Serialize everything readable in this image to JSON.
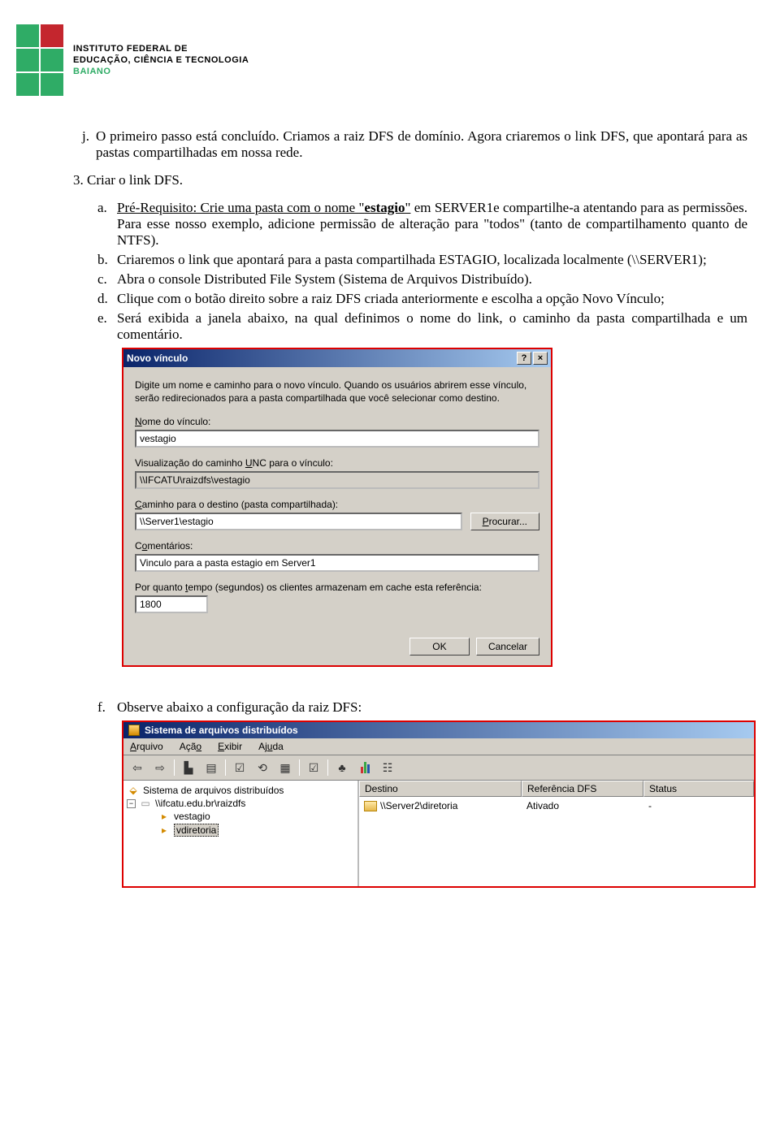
{
  "logo": {
    "line1": "INSTITUTO FEDERAL DE",
    "line2": "EDUCAÇÃO, CIÊNCIA E TECNOLOGIA",
    "line3": "BAIANO"
  },
  "item_j": {
    "marker": "j.",
    "text": "O primeiro passo está concluído. Criamos a raiz DFS de domínio. Agora criaremos o link DFS, que apontará para as pastas compartilhadas em nossa rede."
  },
  "step3": {
    "marker": "3.",
    "text": "Criar o link DFS."
  },
  "sub": {
    "a": {
      "marker": "a.",
      "pre": "Pré-Requisito: Crie uma pasta com o nome ",
      "quote_open": "\"",
      "link": "estagio",
      "quote_close": "\"",
      "post": " em SERVER1e compartilhe-a atentando para as permissões. Para esse nosso exemplo, adicione permissão de alteração para \"todos\" (tanto de compartilhamento quanto de NTFS)."
    },
    "b": {
      "marker": "b.",
      "text": "Criaremos o link que apontará para a pasta compartilhada ESTAGIO, localizada localmente (\\\\SERVER1);"
    },
    "c": {
      "marker": "c.",
      "text": "Abra o console Distributed File System (Sistema de Arquivos Distribuído)."
    },
    "d": {
      "marker": "d.",
      "text": "Clique com o botão direito sobre a raiz DFS criada anteriormente e escolha a opção Novo Vínculo;"
    },
    "e": {
      "marker": "e.",
      "text": "Será exibida a janela abaixo, na qual definimos o nome do link, o caminho da pasta compartilhada e um comentário."
    },
    "f": {
      "marker": "f.",
      "text": "Observe abaixo a configuração da raiz DFS:"
    }
  },
  "dialog": {
    "title": "Novo vínculo",
    "intro": "Digite um nome e caminho para o novo vínculo. Quando os usuários abrirem esse vínculo, serão redirecionados para a pasta compartilhada que você selecionar como destino.",
    "label_nome_pre": "N",
    "label_nome_post": "ome do vínculo:",
    "val_nome": "vestagio",
    "label_unc_pre": "Visualização do caminho ",
    "label_unc_u": "U",
    "label_unc_post": "NC para o vínculo:",
    "val_unc": "\\\\IFCATU\\raizdfs\\vestagio",
    "label_caminho_pre": "C",
    "label_caminho_post": "aminho para o destino (pasta compartilhada):",
    "val_caminho": "\\\\Server1\\estagio",
    "btn_procurar_pre": "P",
    "btn_procurar_post": "rocurar...",
    "label_coment_pre": "C",
    "label_coment_u": "o",
    "label_coment_post": "mentários:",
    "val_coment": "Vinculo para a pasta estagio em Server1",
    "label_cache_pre": "Por quanto ",
    "label_cache_u": "t",
    "label_cache_post": "empo (segundos) os clientes armazenam em cache esta referência:",
    "val_cache": "1800",
    "btn_ok": "OK",
    "btn_cancel": "Cancelar",
    "help": "?",
    "close": "×"
  },
  "mmc": {
    "title": "Sistema de arquivos distribuídos",
    "menu": {
      "arquivo_u": "A",
      "arquivo": "rquivo",
      "acao": "Açã",
      "acao_u": "o",
      "exibir": "E",
      "exibir_post": "xibir",
      "ajuda": "Aj",
      "ajuda_u": "u",
      "ajuda_post": "da"
    },
    "tree": {
      "root": "Sistema de arquivos distribuídos",
      "server": "\\\\ifcatu.edu.br\\raizdfs",
      "n1": "vestagio",
      "n2": "vdiretoria"
    },
    "cols": {
      "c1": "Destino",
      "c2": "Referência DFS",
      "c3": "Status"
    },
    "row": {
      "dest": "\\\\Server2\\diretoria",
      "ref": "Ativado",
      "status": "-"
    }
  }
}
